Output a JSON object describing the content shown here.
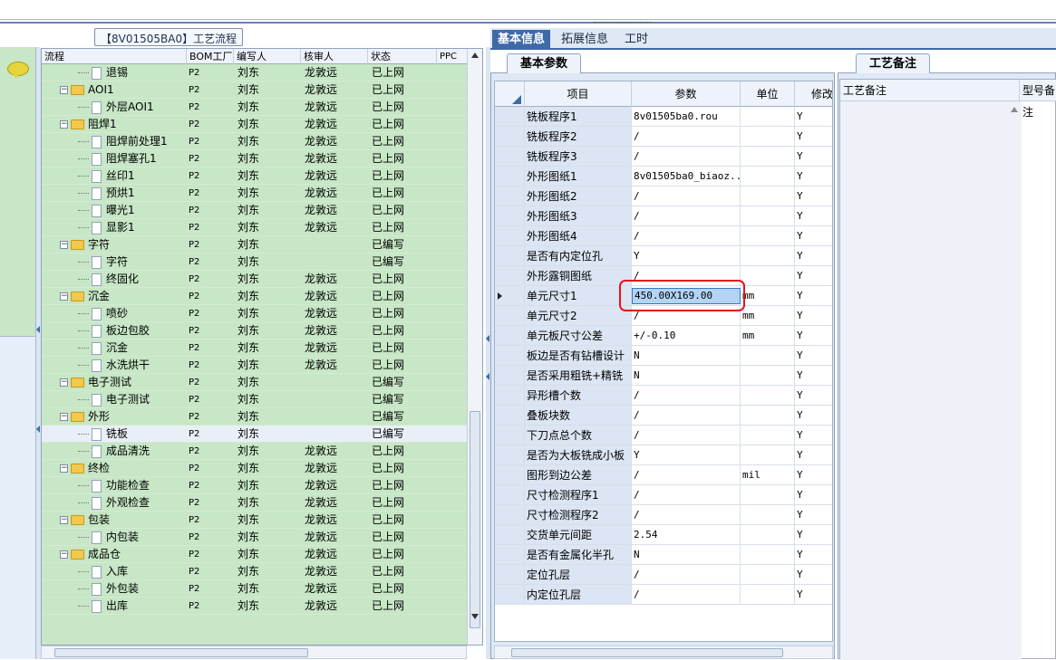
{
  "tree_title": "【8V01505BA0】工艺流程",
  "tree_columns": [
    "流程",
    "BOM工厂",
    "编写人",
    "核审人",
    "状态",
    "PPC"
  ],
  "tree_rows": [
    {
      "name": "退锡",
      "type": "doc",
      "level": 2,
      "bom": "P2",
      "writer": "刘东",
      "reviewer": "龙敦远",
      "status": "已上网"
    },
    {
      "name": "AOI1",
      "type": "folder",
      "level": 1,
      "bom": "P2",
      "writer": "刘东",
      "reviewer": "龙敦远",
      "status": "已上网"
    },
    {
      "name": "外层AOI1",
      "type": "doc",
      "level": 2,
      "bom": "P2",
      "writer": "刘东",
      "reviewer": "龙敦远",
      "status": "已上网"
    },
    {
      "name": "阻焊1",
      "type": "folder",
      "level": 1,
      "bom": "P2",
      "writer": "刘东",
      "reviewer": "龙敦远",
      "status": "已上网"
    },
    {
      "name": "阻焊前处理1",
      "type": "doc",
      "level": 2,
      "bom": "P2",
      "writer": "刘东",
      "reviewer": "龙敦远",
      "status": "已上网"
    },
    {
      "name": "阻焊塞孔1",
      "type": "doc",
      "level": 2,
      "bom": "P2",
      "writer": "刘东",
      "reviewer": "龙敦远",
      "status": "已上网"
    },
    {
      "name": "丝印1",
      "type": "doc",
      "level": 2,
      "bom": "P2",
      "writer": "刘东",
      "reviewer": "龙敦远",
      "status": "已上网"
    },
    {
      "name": "预烘1",
      "type": "doc",
      "level": 2,
      "bom": "P2",
      "writer": "刘东",
      "reviewer": "龙敦远",
      "status": "已上网"
    },
    {
      "name": "曝光1",
      "type": "doc",
      "level": 2,
      "bom": "P2",
      "writer": "刘东",
      "reviewer": "龙敦远",
      "status": "已上网"
    },
    {
      "name": "显影1",
      "type": "doc",
      "level": 2,
      "bom": "P2",
      "writer": "刘东",
      "reviewer": "龙敦远",
      "status": "已上网"
    },
    {
      "name": "字符",
      "type": "folder",
      "level": 1,
      "bom": "P2",
      "writer": "刘东",
      "reviewer": "",
      "status": "已编写"
    },
    {
      "name": "字符",
      "type": "doc",
      "level": 2,
      "bom": "P2",
      "writer": "刘东",
      "reviewer": "",
      "status": "已编写"
    },
    {
      "name": "终固化",
      "type": "doc",
      "level": 2,
      "bom": "P2",
      "writer": "刘东",
      "reviewer": "龙敦远",
      "status": "已上网"
    },
    {
      "name": "沉金",
      "type": "folder",
      "level": 1,
      "bom": "P2",
      "writer": "刘东",
      "reviewer": "龙敦远",
      "status": "已上网"
    },
    {
      "name": "喷砂",
      "type": "doc",
      "level": 2,
      "bom": "P2",
      "writer": "刘东",
      "reviewer": "龙敦远",
      "status": "已上网"
    },
    {
      "name": "板边包胶",
      "type": "doc",
      "level": 2,
      "bom": "P2",
      "writer": "刘东",
      "reviewer": "龙敦远",
      "status": "已上网"
    },
    {
      "name": "沉金",
      "type": "doc",
      "level": 2,
      "bom": "P2",
      "writer": "刘东",
      "reviewer": "龙敦远",
      "status": "已上网"
    },
    {
      "name": "水洗烘干",
      "type": "doc",
      "level": 2,
      "bom": "P2",
      "writer": "刘东",
      "reviewer": "龙敦远",
      "status": "已上网"
    },
    {
      "name": "电子测试",
      "type": "folder",
      "level": 1,
      "bom": "P2",
      "writer": "刘东",
      "reviewer": "",
      "status": "已编写"
    },
    {
      "name": "电子测试",
      "type": "doc",
      "level": 2,
      "bom": "P2",
      "writer": "刘东",
      "reviewer": "",
      "status": "已编写"
    },
    {
      "name": "外形",
      "type": "folder",
      "level": 1,
      "bom": "P2",
      "writer": "刘东",
      "reviewer": "",
      "status": "已编写"
    },
    {
      "name": "铣板",
      "type": "doc",
      "level": 2,
      "bom": "P2",
      "writer": "刘东",
      "reviewer": "",
      "status": "已编写",
      "selected": true
    },
    {
      "name": "成品清洗",
      "type": "doc",
      "level": 2,
      "bom": "P2",
      "writer": "刘东",
      "reviewer": "龙敦远",
      "status": "已上网"
    },
    {
      "name": "终检",
      "type": "folder",
      "level": 1,
      "bom": "P2",
      "writer": "刘东",
      "reviewer": "龙敦远",
      "status": "已上网"
    },
    {
      "name": "功能检查",
      "type": "doc",
      "level": 2,
      "bom": "P2",
      "writer": "刘东",
      "reviewer": "龙敦远",
      "status": "已上网"
    },
    {
      "name": "外观检查",
      "type": "doc",
      "level": 2,
      "bom": "P2",
      "writer": "刘东",
      "reviewer": "龙敦远",
      "status": "已上网"
    },
    {
      "name": "包装",
      "type": "folder",
      "level": 1,
      "bom": "P2",
      "writer": "刘东",
      "reviewer": "龙敦远",
      "status": "已上网"
    },
    {
      "name": "内包装",
      "type": "doc",
      "level": 2,
      "bom": "P2",
      "writer": "刘东",
      "reviewer": "龙敦远",
      "status": "已上网"
    },
    {
      "name": "成品仓",
      "type": "folder",
      "level": 1,
      "bom": "P2",
      "writer": "刘东",
      "reviewer": "龙敦远",
      "status": "已上网"
    },
    {
      "name": "入库",
      "type": "doc",
      "level": 2,
      "bom": "P2",
      "writer": "刘东",
      "reviewer": "龙敦远",
      "status": "已上网"
    },
    {
      "name": "外包装",
      "type": "doc",
      "level": 2,
      "bom": "P2",
      "writer": "刘东",
      "reviewer": "龙敦远",
      "status": "已上网"
    },
    {
      "name": "出库",
      "type": "doc",
      "level": 2,
      "bom": "P2",
      "writer": "刘东",
      "reviewer": "龙敦远",
      "status": "已上网"
    }
  ],
  "main_tabs": [
    "基本信息",
    "拓展信息",
    "工时"
  ],
  "subtab_basic": "基本参数",
  "subtab_notes": "工艺备注",
  "grid_columns": [
    "项目",
    "参数",
    "单位",
    "修改"
  ],
  "grid_rows": [
    {
      "item": "铣板程序1",
      "param": "8v01505ba0.rou",
      "unit": "",
      "mod": "Y"
    },
    {
      "item": "铣板程序2",
      "param": "/",
      "unit": "",
      "mod": "Y"
    },
    {
      "item": "铣板程序3",
      "param": "/",
      "unit": "",
      "mod": "Y"
    },
    {
      "item": "外形图纸1",
      "param": "8v01505ba0_biaoz...",
      "unit": "",
      "mod": "Y"
    },
    {
      "item": "外形图纸2",
      "param": "/",
      "unit": "",
      "mod": "Y"
    },
    {
      "item": "外形图纸3",
      "param": "/",
      "unit": "",
      "mod": "Y"
    },
    {
      "item": "外形图纸4",
      "param": "/",
      "unit": "",
      "mod": "Y"
    },
    {
      "item": "是否有内定位孔",
      "param": "Y",
      "unit": "",
      "mod": "Y"
    },
    {
      "item": "外形露铜图纸",
      "param": "/",
      "unit": "",
      "mod": "Y"
    },
    {
      "item": "单元尺寸1",
      "param": "450.00X169.00",
      "unit": "mm",
      "mod": "Y",
      "editing": true
    },
    {
      "item": "单元尺寸2",
      "param": "/",
      "unit": "mm",
      "mod": "Y"
    },
    {
      "item": "单元板尺寸公差",
      "param": "+/-0.10",
      "unit": "mm",
      "mod": "Y"
    },
    {
      "item": "板边是否有钻槽设计",
      "param": "N",
      "unit": "",
      "mod": "Y"
    },
    {
      "item": "是否采用粗铣+精铣",
      "param": "N",
      "unit": "",
      "mod": "Y"
    },
    {
      "item": "异形槽个数",
      "param": "/",
      "unit": "",
      "mod": "Y"
    },
    {
      "item": "叠板块数",
      "param": "/",
      "unit": "",
      "mod": "Y"
    },
    {
      "item": "下刀点总个数",
      "param": "/",
      "unit": "",
      "mod": "Y"
    },
    {
      "item": "是否为大板铣成小板",
      "param": "Y",
      "unit": "",
      "mod": "Y"
    },
    {
      "item": "图形到边公差",
      "param": "/",
      "unit": "mil",
      "mod": "Y"
    },
    {
      "item": "尺寸检测程序1",
      "param": "/",
      "unit": "",
      "mod": "Y"
    },
    {
      "item": "尺寸检测程序2",
      "param": "/",
      "unit": "",
      "mod": "Y"
    },
    {
      "item": "交货单元间距",
      "param": "2.54",
      "unit": "",
      "mod": "Y"
    },
    {
      "item": "是否有金属化半孔",
      "param": "N",
      "unit": "",
      "mod": "Y"
    },
    {
      "item": "定位孔层",
      "param": "/",
      "unit": "",
      "mod": "Y"
    },
    {
      "item": "内定位孔层",
      "param": "/",
      "unit": "",
      "mod": "Y"
    }
  ],
  "notes_columns": [
    "工艺备注",
    "型号备注"
  ]
}
